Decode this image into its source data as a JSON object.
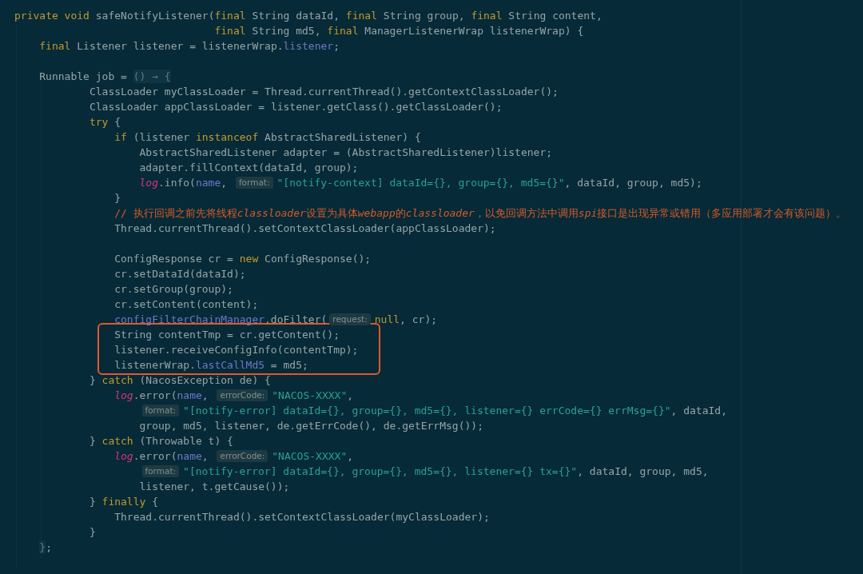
{
  "editor": {
    "lines": [
      {
        "kind": "declaration",
        "segments": [
          {
            "kind": "code",
            "tokens": [
              {
                "kind": "kw",
                "text": "private void"
              },
              {
                "kind": "plain",
                "text": " safeNotifyListener("
              },
              {
                "kind": "kw",
                "text": "final"
              },
              {
                "kind": "plain",
                "text": " String dataId, "
              },
              {
                "kind": "kw",
                "text": "final"
              },
              {
                "kind": "plain",
                "text": " String group, "
              },
              {
                "kind": "kw",
                "text": "final"
              },
              {
                "kind": "plain",
                "text": " String content,"
              }
            ]
          }
        ],
        "wrapped": [
          {
            "kind": "code",
            "segments": [
              {
                "kind": "code",
                "tokens": [
                  {
                    "kind": "kw",
                    "text": "final"
                  },
                  {
                    "kind": "plain",
                    "text": " String md5, "
                  },
                  {
                    "kind": "kw",
                    "text": "final"
                  },
                  {
                    "kind": "plain",
                    "text": " ManagerListenerWrap listenerWrap) {"
                  }
                ]
              }
            ]
          }
        ],
        "children": [
          {
            "kind": "code",
            "segments": [
              {
                "kind": "code",
                "tokens": [
                  {
                    "kind": "kw",
                    "text": "final"
                  },
                  {
                    "kind": "plain",
                    "text": " Listener listener = listenerWrap."
                  },
                  {
                    "kind": "field",
                    "text": "listener"
                  },
                  {
                    "kind": "plain",
                    "text": ";"
                  }
                ]
              }
            ]
          },
          {
            "kind": "blank"
          },
          {
            "kind": "lambda",
            "segments": [
              {
                "kind": "code",
                "tokens": [
                  {
                    "kind": "plain",
                    "text": "Runnable job = "
                  }
                ]
              },
              {
                "kind": "fold",
                "text": "() → {"
              }
            ],
            "children": [
              {
                "kind": "code",
                "segments": [
                  {
                    "kind": "code",
                    "tokens": [
                      {
                        "kind": "plain",
                        "text": "ClassLoader myClassLoader = Thread.currentThread().getContextClassLoader();"
                      }
                    ]
                  }
                ]
              },
              {
                "kind": "code",
                "segments": [
                  {
                    "kind": "code",
                    "tokens": [
                      {
                        "kind": "plain",
                        "text": "ClassLoader appClassLoader = listener.getClass().getClassLoader();"
                      }
                    ]
                  }
                ]
              },
              {
                "kind": "code",
                "segments": [
                  {
                    "kind": "code",
                    "tokens": [
                      {
                        "kind": "kw",
                        "text": "try"
                      },
                      {
                        "kind": "plain",
                        "text": " {"
                      }
                    ]
                  }
                ],
                "children": [
                  {
                    "kind": "code",
                    "segments": [
                      {
                        "kind": "code",
                        "tokens": [
                          {
                            "kind": "kw",
                            "text": "if"
                          },
                          {
                            "kind": "plain",
                            "text": " (listener "
                          },
                          {
                            "kind": "kw",
                            "text": "instanceof"
                          },
                          {
                            "kind": "plain",
                            "text": " AbstractSharedListener) {"
                          }
                        ]
                      }
                    ],
                    "children": [
                      {
                        "kind": "code",
                        "segments": [
                          {
                            "kind": "code",
                            "tokens": [
                              {
                                "kind": "plain",
                                "text": "AbstractSharedListener adapter = (AbstractSharedListener)listener;"
                              }
                            ]
                          }
                        ]
                      },
                      {
                        "kind": "code",
                        "segments": [
                          {
                            "kind": "code",
                            "tokens": [
                              {
                                "kind": "plain",
                                "text": "adapter.fillContext(dataId, group);"
                              }
                            ]
                          }
                        ]
                      },
                      {
                        "kind": "code",
                        "segments": [
                          {
                            "kind": "code",
                            "tokens": [
                              {
                                "kind": "static",
                                "text": "log"
                              },
                              {
                                "kind": "plain",
                                "text": ".info("
                              },
                              {
                                "kind": "field",
                                "text": "name"
                              },
                              {
                                "kind": "plain",
                                "text": ", "
                              }
                            ]
                          },
                          {
                            "kind": "hint",
                            "text": "format:"
                          },
                          {
                            "kind": "code",
                            "tokens": [
                              {
                                "kind": "str",
                                "text": "\"[notify-context] dataId={}, group={}, md5={}\""
                              },
                              {
                                "kind": "plain",
                                "text": ", dataId, group, md5);"
                              }
                            ]
                          }
                        ]
                      }
                    ]
                  },
                  {
                    "kind": "code",
                    "segments": [
                      {
                        "kind": "code",
                        "tokens": [
                          {
                            "kind": "plain",
                            "text": "}"
                          }
                        ]
                      }
                    ]
                  },
                  {
                    "kind": "code",
                    "segments": [
                      {
                        "kind": "code",
                        "tokens": [
                          {
                            "kind": "comment",
                            "text": "// 执行回调之前先将线程"
                          },
                          {
                            "kind": "comment_em",
                            "text": "classloader"
                          },
                          {
                            "kind": "comment",
                            "text": "设置为具体"
                          },
                          {
                            "kind": "comment_em",
                            "text": "webapp"
                          },
                          {
                            "kind": "comment",
                            "text": "的"
                          },
                          {
                            "kind": "comment_em",
                            "text": "classloader"
                          },
                          {
                            "kind": "comment",
                            "text": "，以免回调方法中调用"
                          },
                          {
                            "kind": "comment_em",
                            "text": "spi"
                          },
                          {
                            "kind": "comment",
                            "text": "接口是出现异常或错用（多应用部署才会有该问题）。"
                          }
                        ]
                      }
                    ]
                  },
                  {
                    "kind": "code",
                    "segments": [
                      {
                        "kind": "code",
                        "tokens": [
                          {
                            "kind": "plain",
                            "text": "Thread.currentThread().setContextClassLoader(appClassLoader);"
                          }
                        ]
                      }
                    ]
                  },
                  {
                    "kind": "blank"
                  },
                  {
                    "kind": "code",
                    "segments": [
                      {
                        "kind": "code",
                        "tokens": [
                          {
                            "kind": "plain",
                            "text": "ConfigResponse cr = "
                          },
                          {
                            "kind": "kw",
                            "text": "new"
                          },
                          {
                            "kind": "plain",
                            "text": " ConfigResponse();"
                          }
                        ]
                      }
                    ]
                  },
                  {
                    "kind": "code",
                    "segments": [
                      {
                        "kind": "code",
                        "tokens": [
                          {
                            "kind": "plain",
                            "text": "cr.setDataId(dataId);"
                          }
                        ]
                      }
                    ]
                  },
                  {
                    "kind": "code",
                    "segments": [
                      {
                        "kind": "code",
                        "tokens": [
                          {
                            "kind": "plain",
                            "text": "cr.setGroup(group);"
                          }
                        ]
                      }
                    ]
                  },
                  {
                    "kind": "code",
                    "segments": [
                      {
                        "kind": "code",
                        "tokens": [
                          {
                            "kind": "plain",
                            "text": "cr.setContent(content);"
                          }
                        ]
                      }
                    ]
                  },
                  {
                    "kind": "code",
                    "segments": [
                      {
                        "kind": "code",
                        "tokens": [
                          {
                            "kind": "field",
                            "text": "configFilterChainManager"
                          },
                          {
                            "kind": "plain",
                            "text": ".doFilter("
                          }
                        ]
                      },
                      {
                        "kind": "hint",
                        "text": "request:"
                      },
                      {
                        "kind": "code",
                        "tokens": [
                          {
                            "kind": "kw",
                            "text": "null"
                          },
                          {
                            "kind": "plain",
                            "text": ", cr);"
                          }
                        ]
                      }
                    ]
                  },
                  {
                    "kind": "highlight",
                    "lines": [
                      {
                        "kind": "code",
                        "segments": [
                          {
                            "kind": "code",
                            "tokens": [
                              {
                                "kind": "plain",
                                "text": "String contentTmp = cr.getContent();"
                              }
                            ]
                          }
                        ]
                      },
                      {
                        "kind": "code",
                        "segments": [
                          {
                            "kind": "code",
                            "tokens": [
                              {
                                "kind": "plain",
                                "text": "listener.receiveConfigInfo(contentTmp);"
                              }
                            ]
                          }
                        ]
                      },
                      {
                        "kind": "code",
                        "segments": [
                          {
                            "kind": "code",
                            "tokens": [
                              {
                                "kind": "plain",
                                "text": "listenerWrap."
                              },
                              {
                                "kind": "field",
                                "text": "lastCallMd5"
                              },
                              {
                                "kind": "plain",
                                "text": " = md5;"
                              }
                            ]
                          }
                        ]
                      }
                    ]
                  }
                ]
              },
              {
                "kind": "code",
                "segments": [
                  {
                    "kind": "code",
                    "tokens": [
                      {
                        "kind": "plain",
                        "text": "} "
                      },
                      {
                        "kind": "kw",
                        "text": "catch"
                      },
                      {
                        "kind": "plain",
                        "text": " (NacosException de) {"
                      }
                    ]
                  }
                ],
                "children": [
                  {
                    "kind": "code",
                    "segments": [
                      {
                        "kind": "code",
                        "tokens": [
                          {
                            "kind": "static",
                            "text": "log"
                          },
                          {
                            "kind": "plain",
                            "text": ".error("
                          },
                          {
                            "kind": "field",
                            "text": "name"
                          },
                          {
                            "kind": "plain",
                            "text": ", "
                          }
                        ]
                      },
                      {
                        "kind": "hint",
                        "text": "errorCode:"
                      },
                      {
                        "kind": "code",
                        "tokens": [
                          {
                            "kind": "str",
                            "text": "\"NACOS-XXXX\""
                          },
                          {
                            "kind": "plain",
                            "text": ","
                          }
                        ]
                      }
                    ],
                    "wrapped": [
                      {
                        "kind": "code",
                        "segments": [
                          {
                            "kind": "hint",
                            "text": "format:"
                          },
                          {
                            "kind": "code",
                            "tokens": [
                              {
                                "kind": "str",
                                "text": "\"[notify-error] dataId={}, group={}, md5={}, listener={} errCode={} errMsg={}\""
                              },
                              {
                                "kind": "plain",
                                "text": ", dataId,"
                              }
                            ]
                          }
                        ]
                      },
                      {
                        "kind": "code",
                        "segments": [
                          {
                            "kind": "code",
                            "tokens": [
                              {
                                "kind": "plain",
                                "text": "group, md5, listener, de.getErrCode(), de.getErrMsg());"
                              }
                            ]
                          }
                        ]
                      }
                    ]
                  }
                ]
              },
              {
                "kind": "code",
                "segments": [
                  {
                    "kind": "code",
                    "tokens": [
                      {
                        "kind": "plain",
                        "text": "} "
                      },
                      {
                        "kind": "kw",
                        "text": "catch"
                      },
                      {
                        "kind": "plain",
                        "text": " (Throwable t) {"
                      }
                    ]
                  }
                ],
                "children": [
                  {
                    "kind": "code",
                    "segments": [
                      {
                        "kind": "code",
                        "tokens": [
                          {
                            "kind": "static",
                            "text": "log"
                          },
                          {
                            "kind": "plain",
                            "text": ".error("
                          },
                          {
                            "kind": "field",
                            "text": "name"
                          },
                          {
                            "kind": "plain",
                            "text": ", "
                          }
                        ]
                      },
                      {
                        "kind": "hint",
                        "text": "errorCode:"
                      },
                      {
                        "kind": "code",
                        "tokens": [
                          {
                            "kind": "str",
                            "text": "\"NACOS-XXXX\""
                          },
                          {
                            "kind": "plain",
                            "text": ","
                          }
                        ]
                      }
                    ],
                    "wrapped": [
                      {
                        "kind": "code",
                        "segments": [
                          {
                            "kind": "hint",
                            "text": "format:"
                          },
                          {
                            "kind": "code",
                            "tokens": [
                              {
                                "kind": "str",
                                "text": "\"[notify-error] dataId={}, group={}, md5={}, listener={} tx={}\""
                              },
                              {
                                "kind": "plain",
                                "text": ", dataId, group, md5,"
                              }
                            ]
                          }
                        ]
                      },
                      {
                        "kind": "code",
                        "segments": [
                          {
                            "kind": "code",
                            "tokens": [
                              {
                                "kind": "plain",
                                "text": "listener, t.getCause());"
                              }
                            ]
                          }
                        ]
                      }
                    ]
                  }
                ]
              },
              {
                "kind": "code",
                "segments": [
                  {
                    "kind": "code",
                    "tokens": [
                      {
                        "kind": "plain",
                        "text": "} "
                      },
                      {
                        "kind": "kw",
                        "text": "finally"
                      },
                      {
                        "kind": "plain",
                        "text": " {"
                      }
                    ]
                  }
                ],
                "children": [
                  {
                    "kind": "code",
                    "segments": [
                      {
                        "kind": "code",
                        "tokens": [
                          {
                            "kind": "plain",
                            "text": "Thread.currentThread().setContextClassLoader(myClassLoader);"
                          }
                        ]
                      }
                    ]
                  }
                ]
              },
              {
                "kind": "code",
                "segments": [
                  {
                    "kind": "code",
                    "tokens": [
                      {
                        "kind": "plain",
                        "text": "}"
                      }
                    ]
                  }
                ]
              }
            ]
          },
          {
            "kind": "code",
            "segments": [
              {
                "kind": "fold",
                "text": "}"
              },
              {
                "kind": "code",
                "tokens": [
                  {
                    "kind": "plain",
                    "text": ";"
                  }
                ]
              }
            ]
          }
        ]
      }
    ]
  }
}
